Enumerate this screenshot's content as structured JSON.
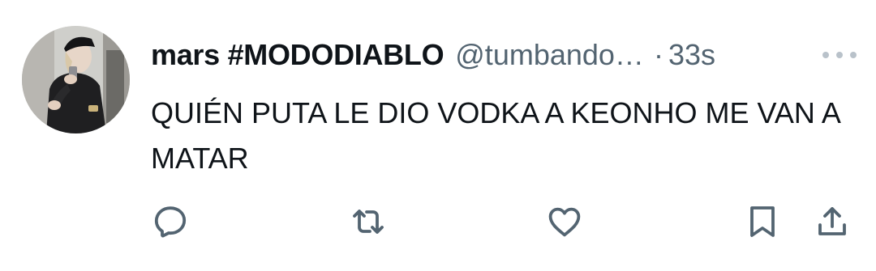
{
  "tweet": {
    "display_name": "mars #MODODIABLO",
    "handle": "@tumbando…",
    "separator": "·",
    "timestamp": "33s",
    "text": "QUIÉN PUTA LE DIO VODKA A KEONHO ME VAN A MATAR"
  },
  "actions": {
    "reply_icon": "reply-icon",
    "retweet_icon": "retweet-icon",
    "like_icon": "heart-icon",
    "bookmark_icon": "bookmark-icon",
    "share_icon": "share-icon"
  },
  "colors": {
    "text_primary": "#0f1419",
    "text_secondary": "#536471",
    "icon": "#536471"
  }
}
